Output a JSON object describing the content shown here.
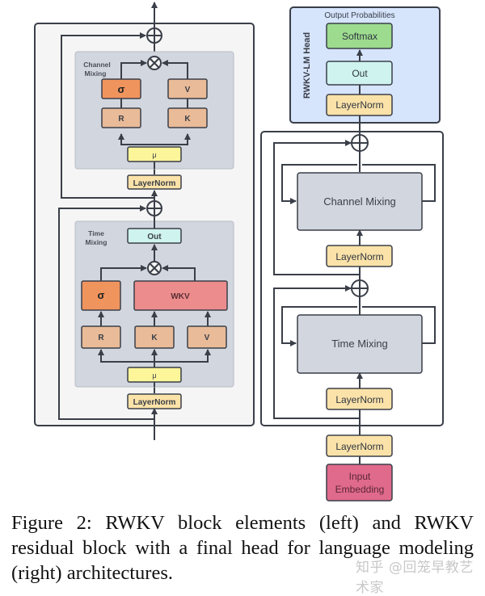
{
  "figure": {
    "left": {
      "channel_mixing": {
        "title_line1": "Channel",
        "title_line2": "Mixing",
        "sigma": "σ",
        "r": "R",
        "v": "V",
        "k": "K",
        "mu": "μ",
        "layernorm": "LayerNorm"
      },
      "time_mixing": {
        "title_line1": "Time",
        "title_line2": "Mixing",
        "out": "Out",
        "sigma": "σ",
        "wkv": "WKV",
        "r": "R",
        "k": "K",
        "v": "V",
        "mu": "μ",
        "layernorm": "LayerNorm"
      }
    },
    "right": {
      "head": {
        "side_label": "RWKV-LM Head",
        "top_label": "Output Probabilities",
        "softmax": "Softmax",
        "out": "Out",
        "layernorm": "LayerNorm"
      },
      "block": {
        "channel_mixing": "Channel Mixing",
        "layernorm_upper": "LayerNorm",
        "time_mixing": "Time Mixing",
        "layernorm_lower": "LayerNorm"
      },
      "input": {
        "layernorm": "LayerNorm",
        "embedding_line1": "Input",
        "embedding_line2": "Embedding"
      }
    },
    "colors": {
      "sigma": "#f0945e",
      "rkv": "#e9bb98",
      "mu": "#fdf59a",
      "layernorm": "#fbe2a8",
      "out": "#cff3ee",
      "wkv": "#ec8c8c",
      "softmax": "#9ddc8e",
      "embedding": "#e06a8b",
      "head_bg": "#d6e4fc",
      "mixing_bg": "#d2d6de",
      "outer_bg": "#f5f5f5",
      "stroke": "#3a3f48"
    }
  },
  "caption": {
    "text": "Figure 2:  RWKV block elements (left) and RWKV residual block with a final head for language modeling (right) architectures."
  },
  "watermark": {
    "text": "知乎 @回笼早教艺术家"
  }
}
